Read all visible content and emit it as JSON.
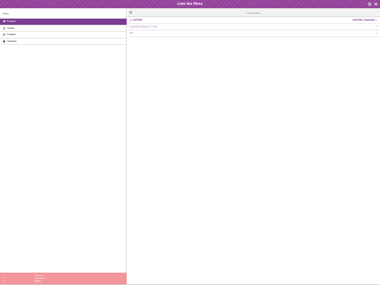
{
  "header": {
    "title": "Liste des filtres",
    "icons": [
      "settings-icon",
      "close-icon"
    ]
  },
  "left": {
    "title": "Filtres",
    "items": [
      {
        "label": "Produits",
        "icon": "tag-icon",
        "active": true
      },
      {
        "label": "Clients",
        "icon": "user-icon",
        "active": false
      },
      {
        "label": "Groupes",
        "icon": "group-icon",
        "active": false
      },
      {
        "label": "Tranches",
        "icon": "slice-icon",
        "active": false
      }
    ],
    "legend": [
      {
        "key": "+",
        "label": "Présence"
      },
      {
        "key": "≠",
        "label": "Inexistence"
      },
      {
        "key": "≥",
        "label": "Validité"
      }
    ]
  },
  "right": {
    "title": "Outil de filtres",
    "rows": [
      {
        "label": "CANTINE",
        "value": "CANTINE | Disponible"
      },
      {
        "label": "CLASSIFICATION ET TYPE",
        "value": ""
      },
      {
        "label": "Prix",
        "value": ""
      }
    ]
  },
  "colors": {
    "header": "#8e3a96",
    "accent": "#7a3d90",
    "legend_bg": "#f3969a"
  }
}
